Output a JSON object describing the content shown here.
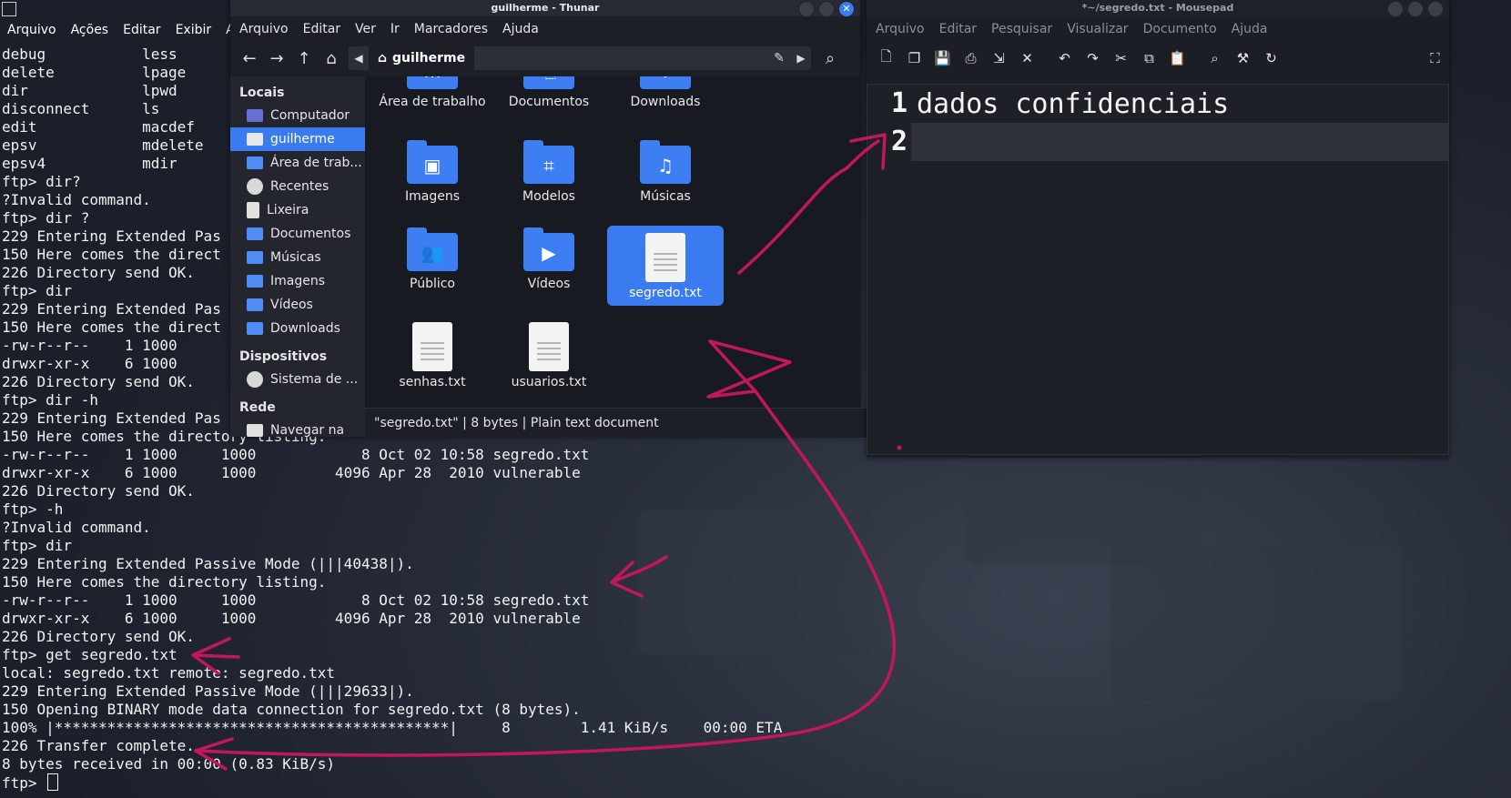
{
  "terminal": {
    "menu": [
      "Arquivo",
      "Ações",
      "Editar",
      "Exibir",
      "Aju"
    ],
    "lines": [
      "debug           less",
      "delete          lpage",
      "dir             lpwd",
      "disconnect      ls",
      "edit            macdef",
      "epsv            mdelete",
      "epsv4           mdir",
      "ftp> dir?",
      "?Invalid command.",
      "ftp> dir ?",
      "229 Entering Extended Pas",
      "150 Here comes the direct",
      "226 Directory send OK.",
      "ftp> dir",
      "229 Entering Extended Pas",
      "150 Here comes the direct",
      "-rw-r--r--    1 1000",
      "drwxr-xr-x    6 1000",
      "226 Directory send OK.",
      "ftp> dir -h",
      "229 Entering Extended Pas",
      "150 Here comes the directory listing.",
      "-rw-r--r--    1 1000     1000            8 Oct 02 10:58 segredo.txt",
      "drwxr-xr-x    6 1000     1000         4096 Apr 28  2010 vulnerable",
      "226 Directory send OK.",
      "ftp> -h",
      "?Invalid command.",
      "ftp> dir",
      "229 Entering Extended Passive Mode (|||40438|).",
      "150 Here comes the directory listing.",
      "-rw-r--r--    1 1000     1000            8 Oct 02 10:58 segredo.txt",
      "drwxr-xr-x    6 1000     1000         4096 Apr 28  2010 vulnerable",
      "226 Directory send OK.",
      "ftp> get segredo.txt",
      "local: segredo.txt remote: segredo.txt",
      "229 Entering Extended Passive Mode (|||29633|).",
      "150 Opening BINARY mode data connection for segredo.txt (8 bytes).",
      "100% |*********************************************|     8        1.41 KiB/s    00:00 ETA",
      "226 Transfer complete.",
      "8 bytes received in 00:00 (0.83 KiB/s)"
    ],
    "prompt": "ftp> "
  },
  "thunar": {
    "title": "guilherme - Thunar",
    "menu": [
      "Arquivo",
      "Editar",
      "Ver",
      "Ir",
      "Marcadores",
      "Ajuda"
    ],
    "path_crumb": "guilherme",
    "sidebar": {
      "locais_header": "Locais",
      "locais": [
        "Computador",
        "guilherme",
        "Área de trab...",
        "Recentes",
        "Lixeira",
        "Documentos",
        "Músicas",
        "Imagens",
        "Vídeos",
        "Downloads"
      ],
      "dispositivos_header": "Dispositivos",
      "dispositivos": [
        "Sistema de ..."
      ],
      "rede_header": "Rede",
      "rede": [
        "Navegar na"
      ]
    },
    "files": [
      "Área de trabalho",
      "Documentos",
      "Downloads",
      "Imagens",
      "Modelos",
      "Músicas",
      "Público",
      "Vídeos",
      "segredo.txt",
      "senhas.txt",
      "usuarios.txt"
    ],
    "status": "\"segredo.txt\" | 8 bytes | Plain text document"
  },
  "mousepad": {
    "title": "*~/segredo.txt - Mousepad",
    "menu": [
      "Arquivo",
      "Editar",
      "Pesquisar",
      "Visualizar",
      "Documento",
      "Ajuda"
    ],
    "lines": [
      {
        "num": "1",
        "text": "dados confidenciais"
      },
      {
        "num": "2",
        "text": ""
      }
    ]
  },
  "colors": {
    "accent": "#3a7cf0",
    "annotation": "#c2185b"
  }
}
